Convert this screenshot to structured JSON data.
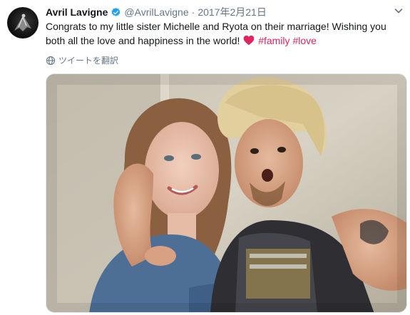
{
  "tweet": {
    "author_name": "Avril Lavigne",
    "handle": "@AvrilLavigne",
    "separator": "·",
    "date": "2017年2月21日",
    "text_part1": "Congrats to my little sister Michelle and Ryota on their marriage! Wishing you both all the love and happiness in the world!",
    "hashtags": [
      "#family",
      "#love"
    ],
    "translate_label": "ツイートを翻訳"
  },
  "colors": {
    "hashtag": "#e0245e",
    "verified": "#1da1f2",
    "secondary_text": "#657786",
    "heart": "#e0245e"
  },
  "icons": {
    "verified": "verified-badge-icon",
    "heart": "heart-icon",
    "menu": "chevron-down-icon",
    "translate": "globe-icon"
  }
}
